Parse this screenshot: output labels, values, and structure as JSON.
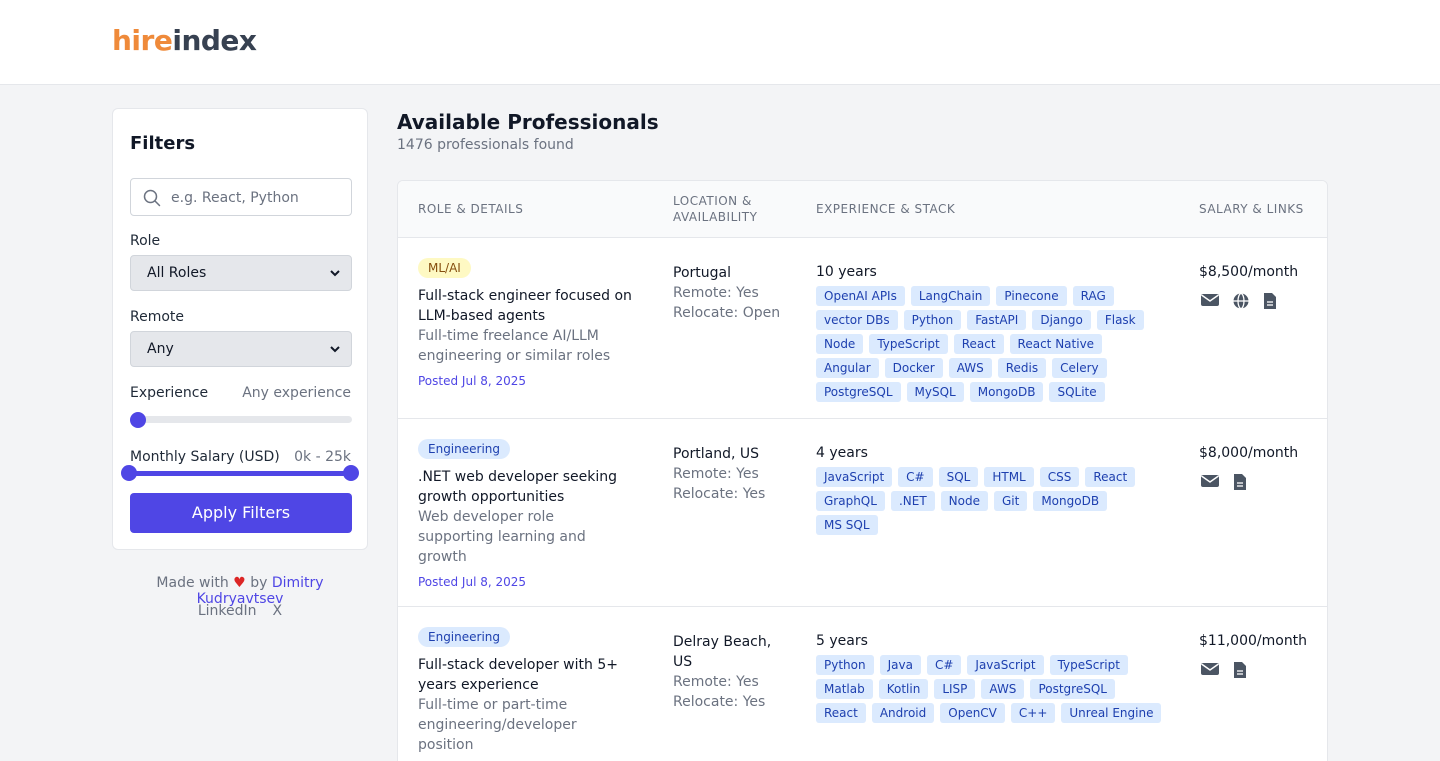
{
  "brand": {
    "part1": "hire",
    "part2": "index"
  },
  "filters": {
    "heading": "Filters",
    "search_placeholder": "e.g. React, Python",
    "role_label": "Role",
    "role_value": "All Roles",
    "remote_label": "Remote",
    "remote_value": "Any",
    "experience_label": "Experience",
    "experience_value": "Any experience",
    "experience_level": 0,
    "salary_label": "Monthly Salary (USD)",
    "salary_value": "0k - 25k",
    "salary_range_fraction": [
      0,
      1
    ],
    "apply_label": "Apply Filters"
  },
  "footer": {
    "made_with": "Made with",
    "heart": "♥",
    "by": "by",
    "author": "Dimitry Kudryavtsev",
    "linkedin": "LinkedIn",
    "x": "X"
  },
  "main": {
    "title": "Available Professionals",
    "count": "1476 professionals found"
  },
  "table": {
    "headers": {
      "role": "ROLE & DETAILS",
      "location": "LOCATION & AVAILABILITY",
      "experience": "EXPERIENCE & STACK",
      "salary": "SALARY & LINKS"
    },
    "rows": [
      {
        "category": "ML/AI",
        "title": "Full-stack engineer focused on LLM-based agents",
        "subtitle": "Full-time freelance AI/LLM engineering or similar roles",
        "posted": "Posted Jul 8, 2025",
        "location": "Portugal",
        "remote": "Remote: Yes",
        "relocate": "Relocate: Open",
        "experience": "10 years",
        "tags": [
          "OpenAI APIs",
          "LangChain",
          "Pinecone",
          "RAG",
          "vector DBs",
          "Python",
          "FastAPI",
          "Django",
          "Flask",
          "Node",
          "TypeScript",
          "React",
          "React Native",
          "Angular",
          "Docker",
          "AWS",
          "Redis",
          "Celery",
          "PostgreSQL",
          "MySQL",
          "MongoDB",
          "SQLite"
        ],
        "salary": "$8,500/month",
        "links": [
          "mail-icon",
          "globe-icon",
          "document-icon"
        ]
      },
      {
        "category": "Engineering",
        "title": ".NET web developer seeking growth opportunities",
        "subtitle": "Web developer role supporting learning and growth",
        "posted": "Posted Jul 8, 2025",
        "location": "Portland, US",
        "remote": "Remote: Yes",
        "relocate": "Relocate: Yes",
        "experience": "4 years",
        "tags": [
          "JavaScript",
          "C#",
          "SQL",
          "HTML",
          "CSS",
          "React",
          "GraphQL",
          ".NET",
          "Node",
          "Git",
          "MongoDB",
          "MS SQL"
        ],
        "salary": "$8,000/month",
        "links": [
          "mail-icon",
          "document-icon"
        ]
      },
      {
        "category": "Engineering",
        "title": "Full-stack developer with 5+ years experience",
        "subtitle": "Full-time or part-time engineering/developer position",
        "posted": "",
        "location": "Delray Beach, US",
        "remote": "Remote: Yes",
        "relocate": "Relocate: Yes",
        "experience": "5 years",
        "tags": [
          "Python",
          "Java",
          "C#",
          "JavaScript",
          "TypeScript",
          "Matlab",
          "Kotlin",
          "LISP",
          "AWS",
          "PostgreSQL",
          "React",
          "Android",
          "OpenCV",
          "C++",
          "Unreal Engine"
        ],
        "salary": "$11,000/month",
        "links": [
          "mail-icon",
          "document-icon"
        ]
      }
    ]
  }
}
